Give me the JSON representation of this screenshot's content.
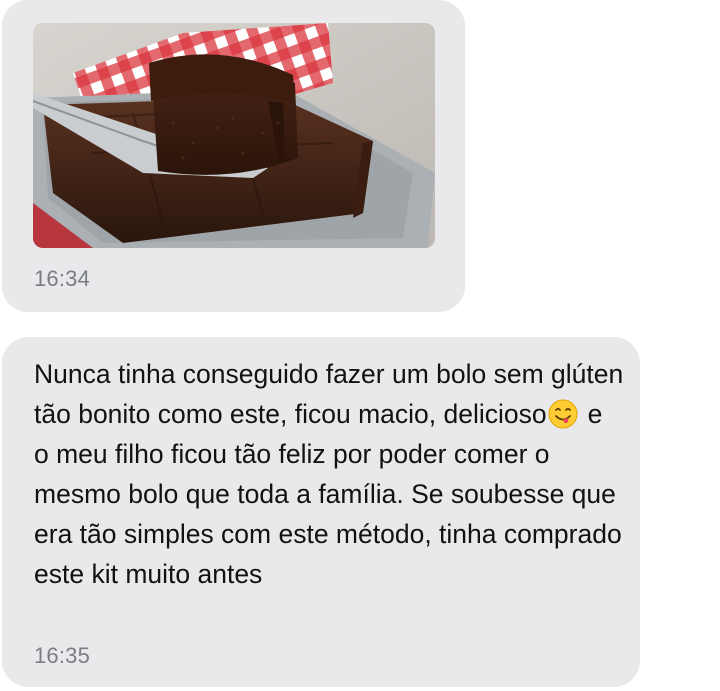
{
  "messages": [
    {
      "type": "image",
      "image_description": "Bolo de chocolate com cobertura numa forma de alumínio, fatia servida com uma espátula, pano xadrez vermelho e branco",
      "time": "16:34"
    },
    {
      "type": "text",
      "text_before_emoji": "Nunca tinha conseguido fazer um bolo sem glúten tão bonito como este, ficou macio, delicioso",
      "emoji": "face-savoring-food-icon",
      "text_after_emoji": "e o meu filho ficou tão feliz por poder comer o mesmo bolo que toda a família. Se soubesse que era tão simples com este método, tinha comprado este kit muito antes",
      "time": "16:35"
    }
  ],
  "colors": {
    "bubble_background": "#e9e9ec",
    "timestamp": "#7a7d85",
    "message_text": "#121212"
  }
}
